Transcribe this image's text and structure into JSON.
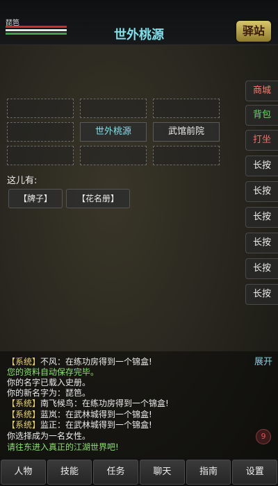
{
  "player": {
    "name": "琵笆"
  },
  "location": {
    "title": "世外桃源"
  },
  "inn_logo": "驿站",
  "side_buttons": [
    "商城",
    "背包",
    "打坐",
    "长按",
    "长按",
    "长按",
    "长按",
    "长按",
    "长按"
  ],
  "side_colors": {
    "shop": "#ff7b6b",
    "bag": "#5ee05e",
    "meditate": "#ff6a6a",
    "default": "#ececec"
  },
  "map": {
    "cells": [
      "",
      "",
      "",
      "",
      "世外桃源",
      "武馆前院",
      "",
      "",
      ""
    ]
  },
  "here": {
    "label": "这儿有:",
    "items": [
      "【牌子】",
      "【花名册】"
    ]
  },
  "messages": [
    {
      "tag": "【系统】",
      "text": "不风：在练功房得到一个锦盒!",
      "color": "white"
    },
    {
      "tag": "",
      "text": "您的资料自动保存完毕。",
      "color": "green"
    },
    {
      "tag": "",
      "text": "你的名字已载入史册。",
      "color": "white"
    },
    {
      "tag": "",
      "text": "你的新名字为：琵笆。",
      "color": "white"
    },
    {
      "tag": "【系统】",
      "text": "南飞候鸟：在练功房得到一个锦盒!",
      "color": "white"
    },
    {
      "tag": "【系统】",
      "text": "蓝岚：在武林城得到一个锦盒!",
      "color": "white"
    },
    {
      "tag": "【系统】",
      "text": "监正：在武林城得到一个锦盒!",
      "color": "white"
    },
    {
      "tag": "",
      "text": "你选择成为一名女性。",
      "color": "white"
    },
    {
      "tag": "",
      "text": "请往东进入真正的江湖世界吧!",
      "color": "green"
    }
  ],
  "expand_label": "展开",
  "badge_count": "9",
  "bottom_nav": [
    "人物",
    "技能",
    "任务",
    "聊天",
    "指南",
    "设置"
  ]
}
